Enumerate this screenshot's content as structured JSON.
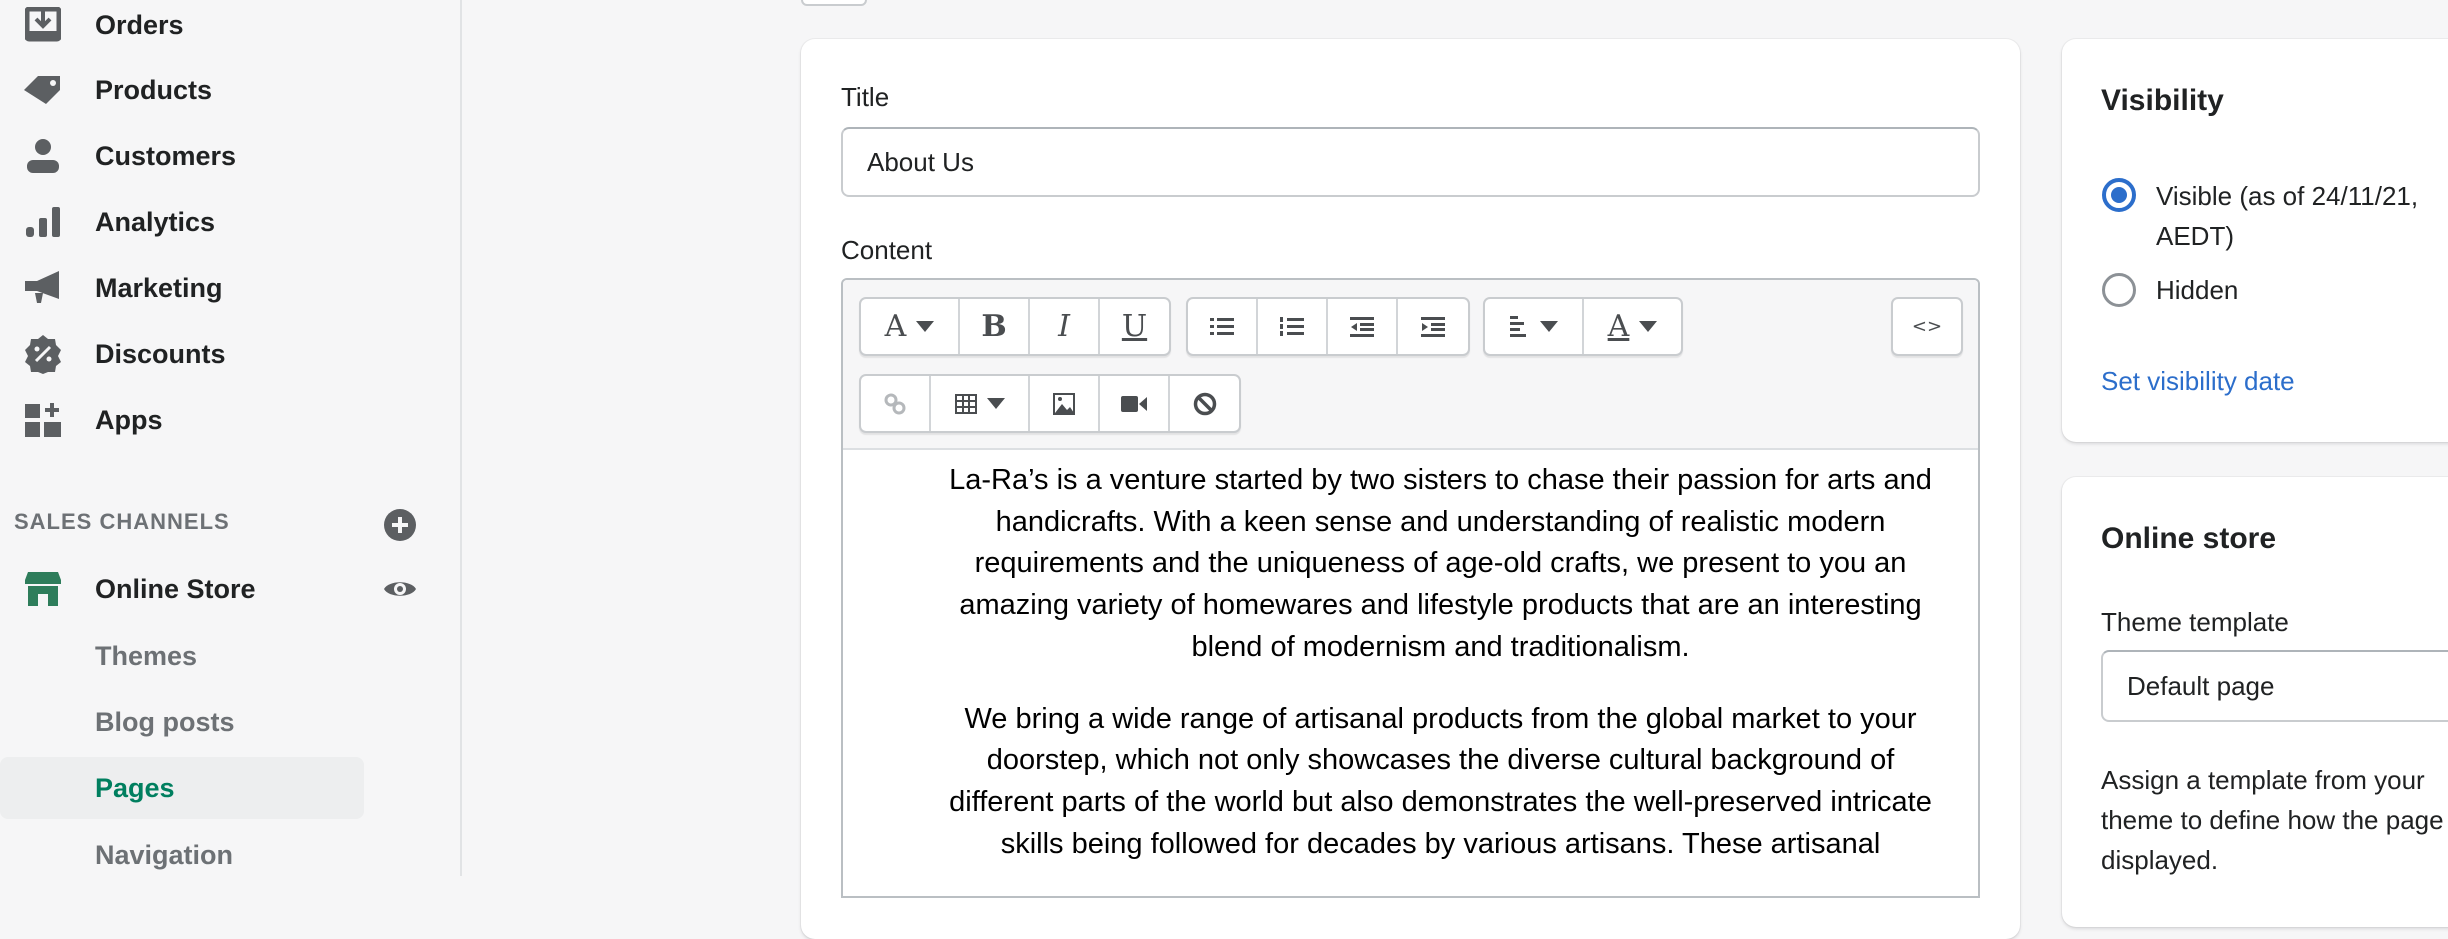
{
  "sidebar": {
    "items": [
      {
        "label": "Orders",
        "icon": "orders-icon"
      },
      {
        "label": "Products",
        "icon": "tag-icon"
      },
      {
        "label": "Customers",
        "icon": "person-icon"
      },
      {
        "label": "Analytics",
        "icon": "bar-chart-icon"
      },
      {
        "label": "Marketing",
        "icon": "megaphone-icon"
      },
      {
        "label": "Discounts",
        "icon": "discount-icon"
      },
      {
        "label": "Apps",
        "icon": "apps-icon"
      }
    ],
    "sales_channels_label": "SALES CHANNELS",
    "online_store": {
      "label": "Online Store",
      "sub": [
        "Themes",
        "Blog posts",
        "Pages",
        "Navigation"
      ],
      "active": "Pages"
    }
  },
  "main": {
    "title_label": "Title",
    "title_value": "About Us",
    "content_label": "Content",
    "code_button": "<>",
    "paragraphs": [
      [
        "La-Ra’s is a venture started by two sisters to chase their passion for arts and",
        "handicrafts. With a keen sense and understanding of realistic modern",
        "requirements and the uniqueness of age-old crafts, we present to you an",
        "amazing variety of homewares and lifestyle products that are an interesting",
        "blend of modernism and traditionalism."
      ],
      [
        "We bring a wide range of artisanal products from the global market to your",
        "doorstep, which not only showcases the diverse cultural background of",
        "different parts of the world but also demonstrates the well-preserved intricate",
        "skills being followed for decades by various artisans. These artisanal"
      ]
    ]
  },
  "visibility": {
    "title": "Visibility",
    "visible_line1": "Visible (as of 24/11/21,",
    "visible_line2": "AEDT)",
    "hidden": "Hidden",
    "set_date": "Set visibility date",
    "selected": "visible"
  },
  "online_store_card": {
    "title": "Online store",
    "theme_label": "Theme template",
    "theme_value": "Default page",
    "help": [
      "Assign a template from your",
      "theme to define how the page",
      "displayed."
    ]
  },
  "colors": {
    "accent": "#2c6ecb",
    "active_green": "#007f5f",
    "radio": "#2c6ecb"
  }
}
